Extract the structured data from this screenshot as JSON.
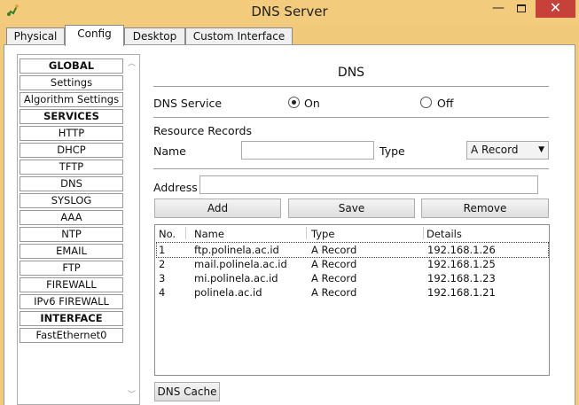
{
  "window": {
    "title": "DNS Server",
    "close_glyph": "✕",
    "minimize_glyph": "—"
  },
  "tabs": [
    "Physical",
    "Config",
    "Desktop",
    "Custom Interface"
  ],
  "sidebar": {
    "items": [
      {
        "label": "GLOBAL",
        "header": true
      },
      {
        "label": "Settings",
        "header": false
      },
      {
        "label": "Algorithm Settings",
        "header": false
      },
      {
        "label": "SERVICES",
        "header": true
      },
      {
        "label": "HTTP",
        "header": false
      },
      {
        "label": "DHCP",
        "header": false
      },
      {
        "label": "TFTP",
        "header": false
      },
      {
        "label": "DNS",
        "header": false
      },
      {
        "label": "SYSLOG",
        "header": false
      },
      {
        "label": "AAA",
        "header": false
      },
      {
        "label": "NTP",
        "header": false
      },
      {
        "label": "EMAIL",
        "header": false
      },
      {
        "label": "FTP",
        "header": false
      },
      {
        "label": "FIREWALL",
        "header": false
      },
      {
        "label": "IPv6 FIREWALL",
        "header": false
      },
      {
        "label": "INTERFACE",
        "header": true
      },
      {
        "label": "FastEthernet0",
        "header": false
      }
    ]
  },
  "dns": {
    "title": "DNS",
    "service_label": "DNS Service",
    "on_label": "On",
    "off_label": "Off",
    "service_on": true,
    "resource_records_label": "Resource Records",
    "name_label": "Name",
    "name_value": "",
    "type_label": "Type",
    "type_value": "A Record",
    "address_label": "Address",
    "address_value": "",
    "add_label": "Add",
    "save_label": "Save",
    "remove_label": "Remove",
    "columns": [
      "No.",
      "Name",
      "Type",
      "Details"
    ],
    "records": [
      {
        "no": "1",
        "name": "ftp.polinela.ac.id",
        "type": "A Record",
        "details": "192.168.1.26"
      },
      {
        "no": "2",
        "name": "mail.polinela.ac.id",
        "type": "A Record",
        "details": "192.168.1.25"
      },
      {
        "no": "3",
        "name": "mi.polinela.ac.id",
        "type": "A Record",
        "details": "192.168.1.23"
      },
      {
        "no": "4",
        "name": "polinela.ac.id",
        "type": "A Record",
        "details": "192.168.1.21"
      }
    ],
    "cache_label": "DNS Cache"
  },
  "colors": {
    "titlebar": "#f3cb7d",
    "close": "#c7413b"
  }
}
